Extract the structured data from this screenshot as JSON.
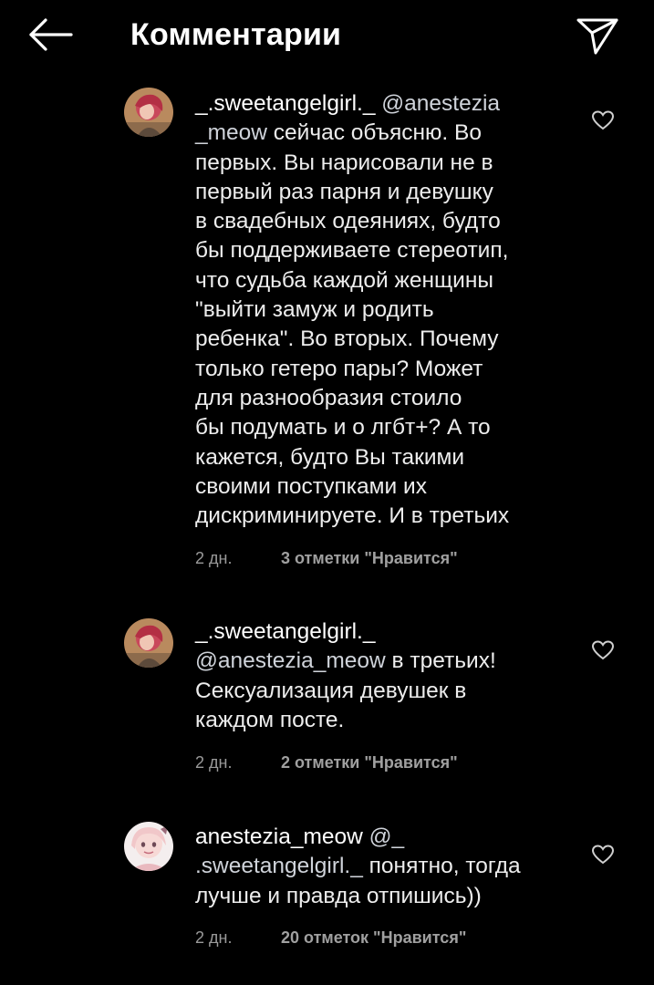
{
  "header": {
    "title": "Комментарии",
    "back_icon": "arrow-left-icon",
    "share_icon": "paper-plane-icon"
  },
  "comments": [
    {
      "username": "_.sweetangelgirl._",
      "line1_mention": "@anestezia",
      "line2_mention": "_meow",
      "line2_rest": " сейчас объясню. Во",
      "lines": [
        "первых. Вы нарисовали не в",
        "первый раз парня и девушку",
        "в свадебных одеяниях, будто",
        "бы поддерживаете стереотип,",
        "что судьба каждой женщины",
        "\"выйти замуж и родить",
        "ребенка\". Во вторых. Почему",
        "только гетеро пары? Может",
        "для разнообразия стоило",
        "бы подумать и о лгбт+? А то",
        "кажется, будто Вы такими",
        "своими поступками их",
        "дискриминируете. И в третьих"
      ],
      "time": "2 дн.",
      "likes": "3 отметки \"Нравится\"",
      "heart_icon": "heart-outline-icon"
    },
    {
      "username": "_.sweetangelgirl._",
      "mention": "@anestezia_meow",
      "line2_rest": " в третьих!",
      "lines": [
        "Сексуализация девушек в",
        "каждом посте."
      ],
      "time": "2 дн.",
      "likes": "2 отметки \"Нравится\"",
      "heart_icon": "heart-outline-icon"
    },
    {
      "username": "anestezia_meow",
      "line1_mention": "@_",
      "line2_mention": ".sweetangelgirl._",
      "line2_rest": " понятно, тогда",
      "lines": [
        "лучше и правда отпишись))"
      ],
      "time": "2 дн.",
      "likes": "20 отметок \"Нравится\"",
      "heart_icon": "heart-outline-icon"
    }
  ]
}
